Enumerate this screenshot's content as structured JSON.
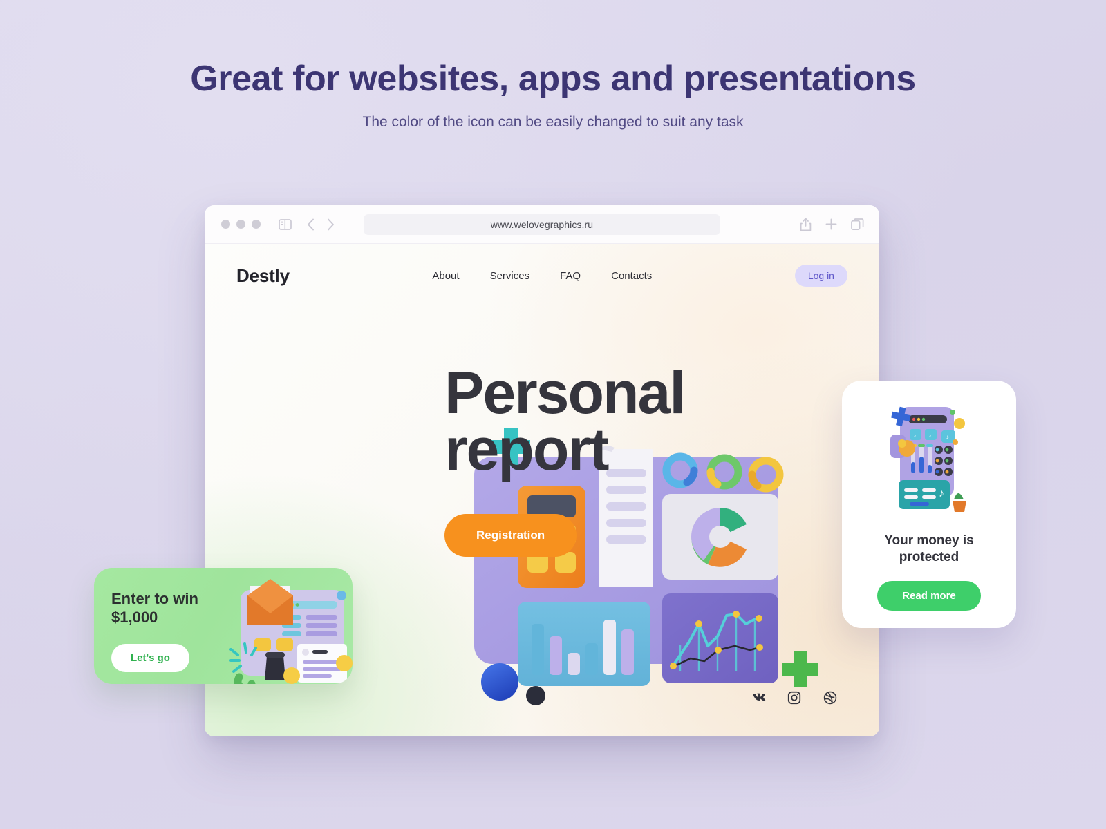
{
  "page": {
    "title": "Great for websites, apps and presentations",
    "subtitle": "The color of the icon can be easily changed to suit any task",
    "background_color": "#dcd8ed",
    "title_color": "#3c3573"
  },
  "browser": {
    "url": "www.welovegraphics.ru",
    "traffic_lights": [
      "close-dot",
      "minimize-dot",
      "maximize-dot"
    ],
    "left_icons": [
      "sidebar-toggle-icon",
      "back-chevron-icon",
      "forward-chevron-icon"
    ],
    "right_icons": [
      "share-icon",
      "new-tab-plus-icon",
      "tabs-overview-icon"
    ]
  },
  "site": {
    "logo": "Destly",
    "menu": [
      {
        "label": "About"
      },
      {
        "label": "Services"
      },
      {
        "label": "FAQ"
      },
      {
        "label": "Contacts"
      }
    ],
    "login_label": "Log in",
    "login_bg": "#ddd9fb",
    "login_color": "#5f57c9",
    "hero": {
      "line1": "Personal",
      "line2": "report",
      "cta_label": "Registration",
      "cta_color": "#f7911e"
    },
    "socials": [
      "vk-icon",
      "instagram-icon",
      "dribbble-icon"
    ]
  },
  "promo_card": {
    "title": "Enter to win\n$1,000",
    "button_label": "Let's go",
    "bg_color": "#a3e7a0",
    "button_text_color": "#2fb14e",
    "illustration": "email-3d-illustration"
  },
  "protected_card": {
    "title": "Your money is\nprotected",
    "button_label": "Read more",
    "button_color": "#3ecf6a",
    "illustration": "mixer-panel-3d-illustration"
  },
  "main_illustration": {
    "name": "analytics-dashboard-3d-illustration",
    "elements": [
      "calculator",
      "receipt",
      "donut-chart",
      "bar-chart",
      "line-chart",
      "rings",
      "spheres",
      "crosses"
    ]
  }
}
